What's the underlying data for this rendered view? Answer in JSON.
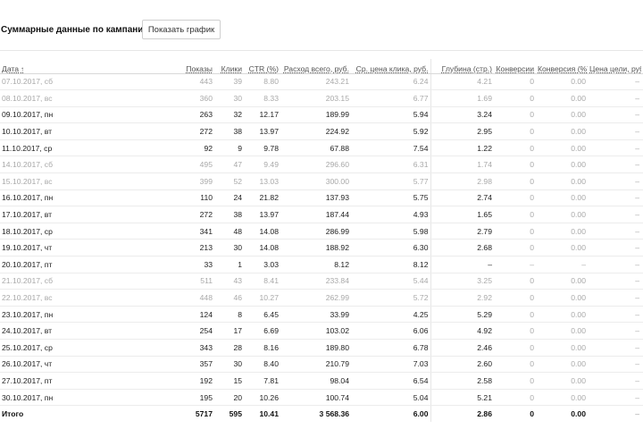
{
  "header": {
    "title": "Суммарные данные по кампании",
    "graph_button": "Показать график"
  },
  "columns": {
    "date": "Дата",
    "shows": "Показы",
    "clicks": "Клики",
    "ctr": "CTR (%)",
    "spend": "Расход всего, руб.",
    "cpc": "Ср. цена клика, руб.",
    "depth": "Глубина (стр.)",
    "conversions": "Конверсии",
    "conv_rate": "Конверсия (%)",
    "goal_cost": "Цена цели, руб.",
    "revenue": "Д"
  },
  "icons": {
    "sort": "sort-ascending-icon"
  },
  "rows": [
    {
      "date": "07.10.2017, сб",
      "shows": "443",
      "clicks": "39",
      "ctr": "8.80",
      "spend": "243.21",
      "cpc": "6.24",
      "depth": "4.21",
      "conv": "0",
      "conv_rate": "0.00",
      "goal": "–",
      "weekend": true
    },
    {
      "date": "08.10.2017, вс",
      "shows": "360",
      "clicks": "30",
      "ctr": "8.33",
      "spend": "203.15",
      "cpc": "6.77",
      "depth": "1.69",
      "conv": "0",
      "conv_rate": "0.00",
      "goal": "–",
      "weekend": true
    },
    {
      "date": "09.10.2017, пн",
      "shows": "263",
      "clicks": "32",
      "ctr": "12.17",
      "spend": "189.99",
      "cpc": "5.94",
      "depth": "3.24",
      "conv": "0",
      "conv_rate": "0.00",
      "goal": "–",
      "weekend": false
    },
    {
      "date": "10.10.2017, вт",
      "shows": "272",
      "clicks": "38",
      "ctr": "13.97",
      "spend": "224.92",
      "cpc": "5.92",
      "depth": "2.95",
      "conv": "0",
      "conv_rate": "0.00",
      "goal": "–",
      "weekend": false
    },
    {
      "date": "11.10.2017, ср",
      "shows": "92",
      "clicks": "9",
      "ctr": "9.78",
      "spend": "67.88",
      "cpc": "7.54",
      "depth": "1.22",
      "conv": "0",
      "conv_rate": "0.00",
      "goal": "–",
      "weekend": false
    },
    {
      "date": "14.10.2017, сб",
      "shows": "495",
      "clicks": "47",
      "ctr": "9.49",
      "spend": "296.60",
      "cpc": "6.31",
      "depth": "1.74",
      "conv": "0",
      "conv_rate": "0.00",
      "goal": "–",
      "weekend": true
    },
    {
      "date": "15.10.2017, вс",
      "shows": "399",
      "clicks": "52",
      "ctr": "13.03",
      "spend": "300.00",
      "cpc": "5.77",
      "depth": "2.98",
      "conv": "0",
      "conv_rate": "0.00",
      "goal": "–",
      "weekend": true
    },
    {
      "date": "16.10.2017, пн",
      "shows": "110",
      "clicks": "24",
      "ctr": "21.82",
      "spend": "137.93",
      "cpc": "5.75",
      "depth": "2.74",
      "conv": "0",
      "conv_rate": "0.00",
      "goal": "–",
      "weekend": false
    },
    {
      "date": "17.10.2017, вт",
      "shows": "272",
      "clicks": "38",
      "ctr": "13.97",
      "spend": "187.44",
      "cpc": "4.93",
      "depth": "1.65",
      "conv": "0",
      "conv_rate": "0.00",
      "goal": "–",
      "weekend": false
    },
    {
      "date": "18.10.2017, ср",
      "shows": "341",
      "clicks": "48",
      "ctr": "14.08",
      "spend": "286.99",
      "cpc": "5.98",
      "depth": "2.79",
      "conv": "0",
      "conv_rate": "0.00",
      "goal": "–",
      "weekend": false
    },
    {
      "date": "19.10.2017, чт",
      "shows": "213",
      "clicks": "30",
      "ctr": "14.08",
      "spend": "188.92",
      "cpc": "6.30",
      "depth": "2.68",
      "conv": "0",
      "conv_rate": "0.00",
      "goal": "–",
      "weekend": false
    },
    {
      "date": "20.10.2017, пт",
      "shows": "33",
      "clicks": "1",
      "ctr": "3.03",
      "spend": "8.12",
      "cpc": "8.12",
      "depth": "–",
      "conv": "–",
      "conv_rate": "–",
      "goal": "–",
      "weekend": false
    },
    {
      "date": "21.10.2017, сб",
      "shows": "511",
      "clicks": "43",
      "ctr": "8.41",
      "spend": "233.84",
      "cpc": "5.44",
      "depth": "3.25",
      "conv": "0",
      "conv_rate": "0.00",
      "goal": "–",
      "weekend": true
    },
    {
      "date": "22.10.2017, вс",
      "shows": "448",
      "clicks": "46",
      "ctr": "10.27",
      "spend": "262.99",
      "cpc": "5.72",
      "depth": "2.92",
      "conv": "0",
      "conv_rate": "0.00",
      "goal": "–",
      "weekend": true
    },
    {
      "date": "23.10.2017, пн",
      "shows": "124",
      "clicks": "8",
      "ctr": "6.45",
      "spend": "33.99",
      "cpc": "4.25",
      "depth": "5.29",
      "conv": "0",
      "conv_rate": "0.00",
      "goal": "–",
      "weekend": false
    },
    {
      "date": "24.10.2017, вт",
      "shows": "254",
      "clicks": "17",
      "ctr": "6.69",
      "spend": "103.02",
      "cpc": "6.06",
      "depth": "4.92",
      "conv": "0",
      "conv_rate": "0.00",
      "goal": "–",
      "weekend": false
    },
    {
      "date": "25.10.2017, ср",
      "shows": "343",
      "clicks": "28",
      "ctr": "8.16",
      "spend": "189.80",
      "cpc": "6.78",
      "depth": "2.46",
      "conv": "0",
      "conv_rate": "0.00",
      "goal": "–",
      "weekend": false
    },
    {
      "date": "26.10.2017, чт",
      "shows": "357",
      "clicks": "30",
      "ctr": "8.40",
      "spend": "210.79",
      "cpc": "7.03",
      "depth": "2.60",
      "conv": "0",
      "conv_rate": "0.00",
      "goal": "–",
      "weekend": false
    },
    {
      "date": "27.10.2017, пт",
      "shows": "192",
      "clicks": "15",
      "ctr": "7.81",
      "spend": "98.04",
      "cpc": "6.54",
      "depth": "2.58",
      "conv": "0",
      "conv_rate": "0.00",
      "goal": "–",
      "weekend": false
    },
    {
      "date": "30.10.2017, пн",
      "shows": "195",
      "clicks": "20",
      "ctr": "10.26",
      "spend": "100.74",
      "cpc": "5.04",
      "depth": "5.21",
      "conv": "0",
      "conv_rate": "0.00",
      "goal": "–",
      "weekend": false
    }
  ],
  "total": {
    "label": "Итого",
    "shows": "5717",
    "clicks": "595",
    "ctr": "10.41",
    "spend": "3 568.36",
    "cpc": "6.00",
    "depth": "2.86",
    "conv": "0",
    "conv_rate": "0.00",
    "goal": "–"
  }
}
